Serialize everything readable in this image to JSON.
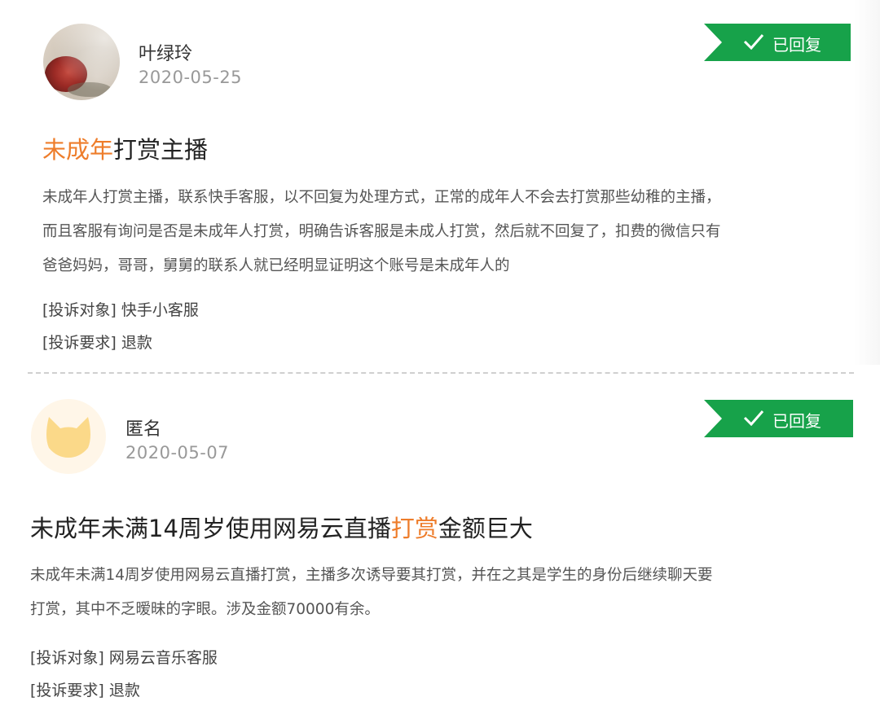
{
  "complaints": [
    {
      "user_name": "叶绿玲",
      "date": "2020-05-25",
      "status": "已回复",
      "title_highlight": "未成年",
      "title_rest": "打赏主播",
      "body_lines": [
        "未成年人打赏主播，联系快手客服，以不回复为处理方式，正常的成年人不会去打赏那些幼稚的主播，",
        "而且客服有询问是否是未成年人打赏，明确告诉客服是未成人打赏，然后就不回复了，扣费的微信只有",
        "爸爸妈妈，哥哥，舅舅的联系人就已经明显证明这个账号是未成年人的"
      ],
      "target_label": "[投诉对象]",
      "target_value": "快手小客服",
      "demand_label": "[投诉要求]",
      "demand_value": "退款"
    },
    {
      "user_name": "匿名",
      "date": "2020-05-07",
      "status": "已回复",
      "title_pre": "未成年未满14周岁使用网易云直播",
      "title_highlight": "打赏",
      "title_post": "金额巨大",
      "body_lines": [
        "未成年未满14周岁使用网易云直播打赏，主播多次诱导要其打赏，并在之其是学生的身份后继续聊天要",
        "打赏，其中不乏暧昧的字眼。涉及金额70000有余。"
      ],
      "target_label": "[投诉对象]",
      "target_value": "网易云音乐客服",
      "demand_label": "[投诉要求]",
      "demand_value": "退款"
    }
  ],
  "colors": {
    "badge_green": "#17a24a",
    "highlight_orange": "#ee7d2b",
    "avatar_anon_yellow": "#fbd989"
  },
  "icons": {
    "status_check": "check-icon",
    "anonymous_avatar": "cat-avatar-icon"
  }
}
